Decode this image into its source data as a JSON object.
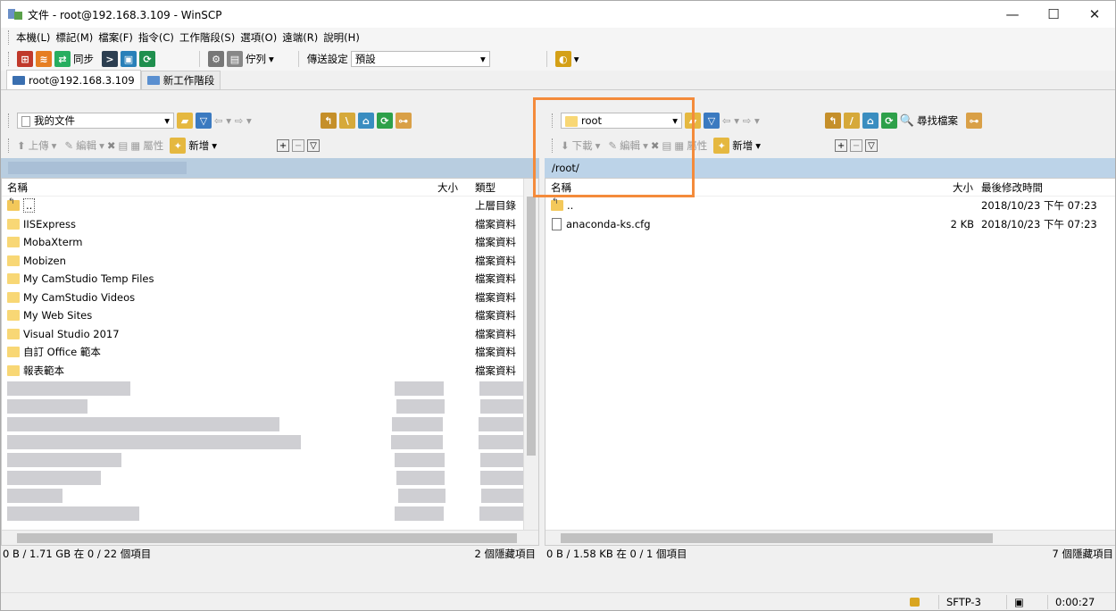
{
  "window": {
    "title": "文件 - root@192.168.3.109 - WinSCP"
  },
  "menu": [
    "本機(L)",
    "標記(M)",
    "檔案(F)",
    "指令(C)",
    "工作階段(S)",
    "選項(O)",
    "遠端(R)",
    "說明(H)"
  ],
  "toolbar": {
    "sync_label": "同步",
    "queue_label": "佇列",
    "transfer_label": "傳送設定",
    "transfer_value": "預設"
  },
  "tabs": [
    {
      "label": "root@192.168.3.109"
    },
    {
      "label": "新工作階段"
    }
  ],
  "left": {
    "location": "我的文件",
    "upload_label": "上傳",
    "edit_label": "編輯",
    "props_label": "屬性",
    "new_label": "新增",
    "columns": {
      "name": "名稱",
      "size": "大小",
      "type": "類型"
    },
    "rows": [
      {
        "name": "..",
        "type": "上層目錄",
        "up": true
      },
      {
        "name": "IISExpress",
        "type": "檔案資料"
      },
      {
        "name": "MobaXterm",
        "type": "檔案資料"
      },
      {
        "name": "Mobizen",
        "type": "檔案資料"
      },
      {
        "name": "My CamStudio Temp Files",
        "type": "檔案資料"
      },
      {
        "name": "My CamStudio Videos",
        "type": "檔案資料"
      },
      {
        "name": "My Web Sites",
        "type": "檔案資料"
      },
      {
        "name": "Visual Studio 2017",
        "type": "檔案資料"
      },
      {
        "name": "自訂 Office 範本",
        "type": "檔案資料"
      },
      {
        "name": "報表範本",
        "type": "檔案資料"
      }
    ],
    "status_left": "0 B / 1.71 GB 在 0 / 22 個項目",
    "status_right": "2 個隱藏項目"
  },
  "right": {
    "location": "root",
    "find_label": "尋找檔案",
    "download_label": "下載",
    "edit_label": "編輯",
    "props_label": "屬性",
    "new_label": "新增",
    "path": "/root/",
    "columns": {
      "name": "名稱",
      "size": "大小",
      "modified": "最後修改時間"
    },
    "rows": [
      {
        "name": "..",
        "size": "",
        "modified": "2018/10/23 下午 07:23",
        "up": true
      },
      {
        "name": "anaconda-ks.cfg",
        "size": "2 KB",
        "modified": "2018/10/23 下午 07:23"
      }
    ],
    "status_left": "0 B / 1.58 KB 在 0 / 1 個項目",
    "status_right": "7 個隱藏項目"
  },
  "statusbar": {
    "protocol": "SFTP-3",
    "time": "0:00:27"
  },
  "colors": {
    "highlight": "#f48b3b",
    "path_bar": "#bcd3e8",
    "folder": "#f8d775"
  }
}
